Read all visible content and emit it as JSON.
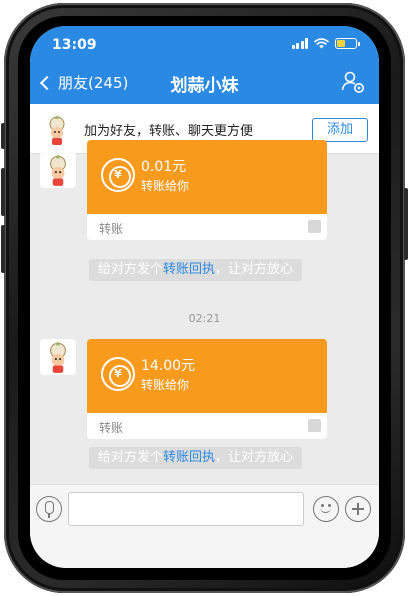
{
  "status_bar": {
    "time": "13:09"
  },
  "nav": {
    "back_label": "朋友(245)",
    "title": "划蒜小妹"
  },
  "banner": {
    "text": "加为好友，转账、聊天更方便",
    "add_button": "添加"
  },
  "messages": [
    {
      "type": "transfer",
      "amount": "0.01元",
      "subtext": "转账给你",
      "label": "转账",
      "receipt_prefix": "给对方发个",
      "receipt_link": "转账回执",
      "receipt_suffix": "，让对方放心"
    },
    {
      "type": "time",
      "text": "02:21"
    },
    {
      "type": "transfer",
      "amount": "14.00元",
      "subtext": "转账给你",
      "label": "转账",
      "receipt_prefix": "给对方发个",
      "receipt_link": "转账回执",
      "receipt_suffix": "，让对方放心"
    }
  ],
  "colors": {
    "nav_blue": "#2a89e3",
    "transfer_orange": "#f89a1c",
    "chat_bg": "#ebebeb"
  },
  "icons": [
    "signal-icon",
    "wifi-icon",
    "battery-icon",
    "back-chevron-icon",
    "profile-settings-icon",
    "yen-coin-icon",
    "voice-icon",
    "emoji-icon",
    "plus-icon"
  ]
}
